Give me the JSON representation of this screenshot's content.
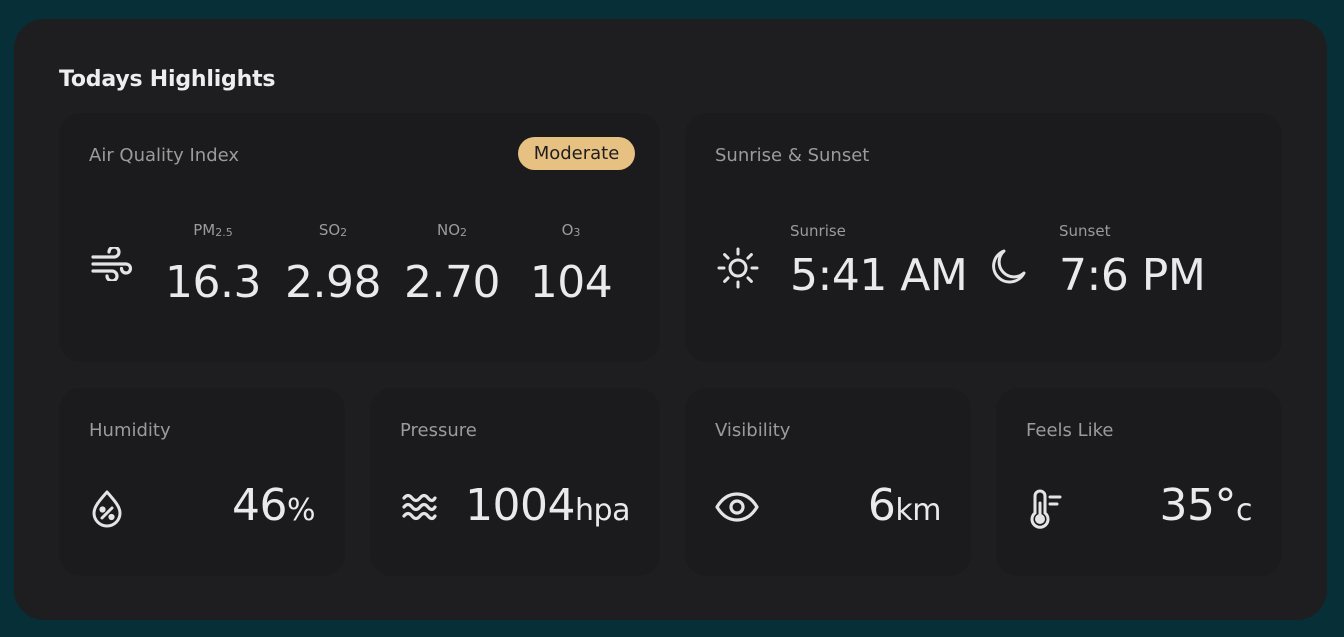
{
  "highlights": {
    "title": "Todays Highlights"
  },
  "aqi": {
    "label": "Air Quality Index",
    "badge": "Moderate",
    "badge_color": "#e7c182",
    "icon": "wind-icon",
    "pollutants": [
      {
        "name": "PM",
        "sub": "2.5",
        "value": "16.3"
      },
      {
        "name": "SO",
        "sub": "2",
        "value": "2.98"
      },
      {
        "name": "NO",
        "sub": "2",
        "value": "2.70"
      },
      {
        "name": "O",
        "sub": "3",
        "value": "104"
      }
    ]
  },
  "sun": {
    "label": "Sunrise & Sunset",
    "sunrise_label": "Sunrise",
    "sunrise_value": "5:41 AM",
    "sunset_label": "Sunset",
    "sunset_value": "7:6 PM",
    "sunrise_icon": "sun-icon",
    "sunset_icon": "moon-icon"
  },
  "humidity": {
    "label": "Humidity",
    "value": "46",
    "unit": "%",
    "icon": "humidity-drop-icon"
  },
  "pressure": {
    "label": "Pressure",
    "value": "1004",
    "unit": "hpa",
    "icon": "waves-icon"
  },
  "visibility": {
    "label": "Visibility",
    "value": "6",
    "unit": "km",
    "icon": "eye-icon"
  },
  "feels_like": {
    "label": "Feels Like",
    "value": "35°",
    "unit": "c",
    "icon": "thermometer-icon"
  }
}
